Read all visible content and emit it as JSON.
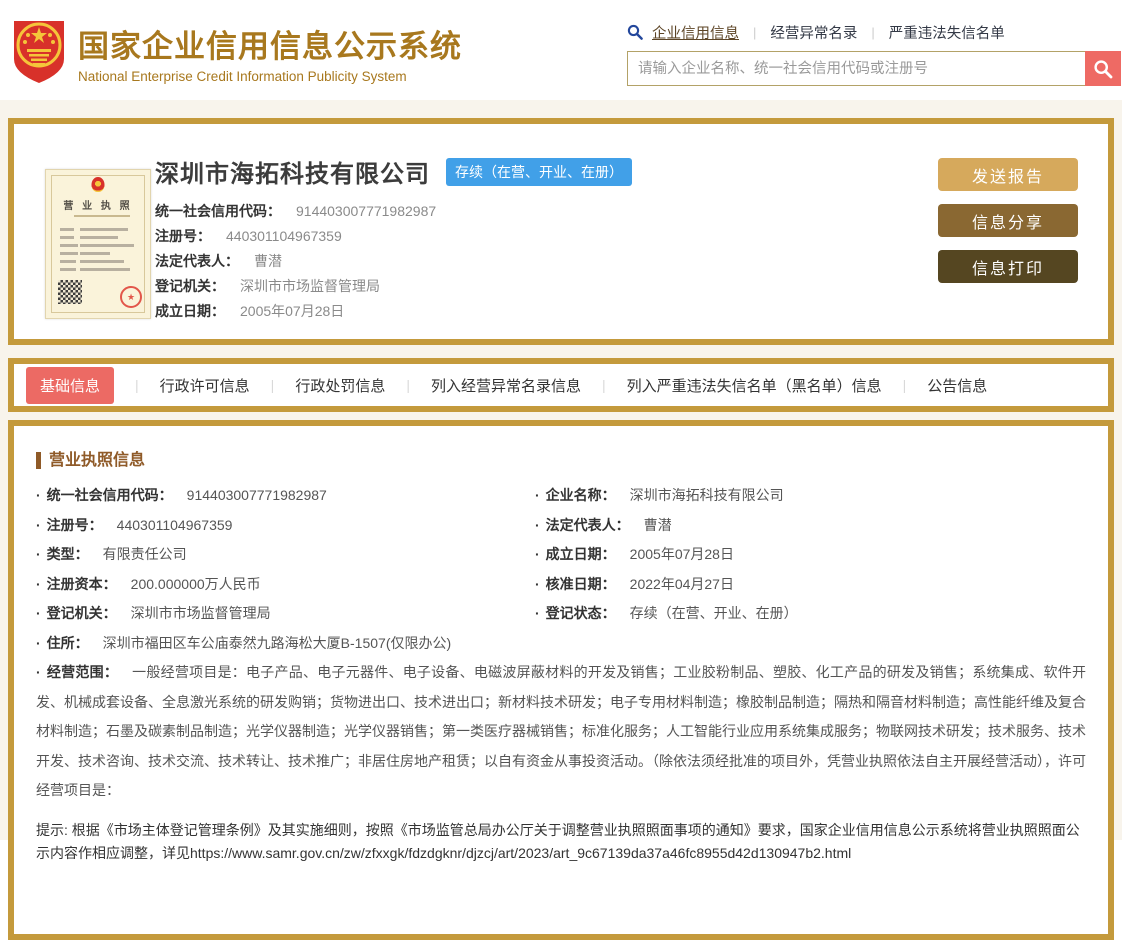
{
  "header": {
    "title": "国家企业信用信息公示系统",
    "subtitle": "National Enterprise Credit Information Publicity System",
    "nav_links": [
      {
        "label": "企业信用信息"
      },
      {
        "label": "经营异常名录"
      },
      {
        "label": "严重违法失信名单"
      }
    ],
    "search": {
      "placeholder": "请输入企业名称、统一社会信用代码或注册号",
      "value": ""
    }
  },
  "summary": {
    "license_thumb_title": "营 业 执 照",
    "license_stamp_glyph": "★",
    "company_name": "深圳市海拓科技有限公司",
    "status_badge": "存续（在营、开业、在册）",
    "fields": [
      {
        "label": "统一社会信用代码：",
        "value": "914403007771982987"
      },
      {
        "label": "注册号：",
        "value": "440301104967359"
      },
      {
        "label": "法定代表人：",
        "value": "曹潜"
      },
      {
        "label": "登记机关：",
        "value": "深圳市市场监督管理局"
      },
      {
        "label": "成立日期：",
        "value": "2005年07月28日"
      }
    ],
    "buttons": [
      {
        "label": "发送报告"
      },
      {
        "label": "信息分享"
      },
      {
        "label": "信息打印"
      }
    ]
  },
  "tabs": [
    {
      "label": "基础信息",
      "active": true
    },
    {
      "label": "行政许可信息",
      "active": false
    },
    {
      "label": "行政处罚信息",
      "active": false
    },
    {
      "label": "列入经营异常名录信息",
      "active": false
    },
    {
      "label": "列入严重违法失信名单（黑名单）信息",
      "active": false
    },
    {
      "label": "公告信息",
      "active": false
    }
  ],
  "detail": {
    "section_title": "营业执照信息",
    "left_fields": [
      {
        "label": "统一社会信用代码：",
        "value": "914403007771982987"
      },
      {
        "label": "注册号：",
        "value": "440301104967359"
      },
      {
        "label": "类型：",
        "value": "有限责任公司"
      },
      {
        "label": "注册资本：",
        "value": "200.000000万人民币"
      },
      {
        "label": "登记机关：",
        "value": "深圳市市场监督管理局"
      }
    ],
    "right_fields": [
      {
        "label": "企业名称：",
        "value": "深圳市海拓科技有限公司"
      },
      {
        "label": "法定代表人：",
        "value": "曹潜"
      },
      {
        "label": "成立日期：",
        "value": "2005年07月28日"
      },
      {
        "label": "核准日期：",
        "value": "2022年04月27日"
      },
      {
        "label": "登记状态：",
        "value": "存续（在营、开业、在册）"
      }
    ],
    "address": {
      "label": "住所：",
      "value": "深圳市福田区车公庙泰然九路海松大厦B-1507(仅限办公)"
    },
    "scope": {
      "label": "经营范围：",
      "value": "一般经营项目是：电子产品、电子元器件、电子设备、电磁波屏蔽材料的开发及销售；工业胶粉制品、塑胶、化工产品的研发及销售；系统集成、软件开发、机械成套设备、全息激光系统的研发购销；货物进出口、技术进出口；新材料技术研发；电子专用材料制造；橡胶制品制造；隔热和隔音材料制造；高性能纤维及复合材料制造；石墨及碳素制品制造；光学仪器制造；光学仪器销售；第一类医疗器械销售；标准化服务；人工智能行业应用系统集成服务；物联网技术研发；技术服务、技术开发、技术咨询、技术交流、技术转让、技术推广；非居住房地产租赁；以自有资金从事投资活动。（除依法须经批准的项目外，凭营业执照依法自主开展经营活动），许可经营项目是："
    },
    "notice": "提示: 根据《市场主体登记管理条例》及其实施细则，按照《市场监管总局办公厅关于调整营业执照照面事项的通知》要求，国家企业信用信息公示系统将营业执照照面公示内容作相应调整，详见https://www.samr.gov.cn/zw/zfxxgk/fdzdgknr/djzcj/art/2023/art_9c67139da37a46fc8955d42d130947b2.html"
  },
  "colors": {
    "title_gold": "#a8781e",
    "card_border_gold": "#c49a3c",
    "page_bg": "#f8f4ec",
    "active_tab_red": "#ec6a64",
    "search_button_red": "#ee6a64",
    "status_badge_blue": "#41a0e8",
    "button_report": "#d6a95c",
    "button_share": "#8a6832",
    "button_print": "#554621",
    "section_title_brown": "#8f5a28"
  }
}
